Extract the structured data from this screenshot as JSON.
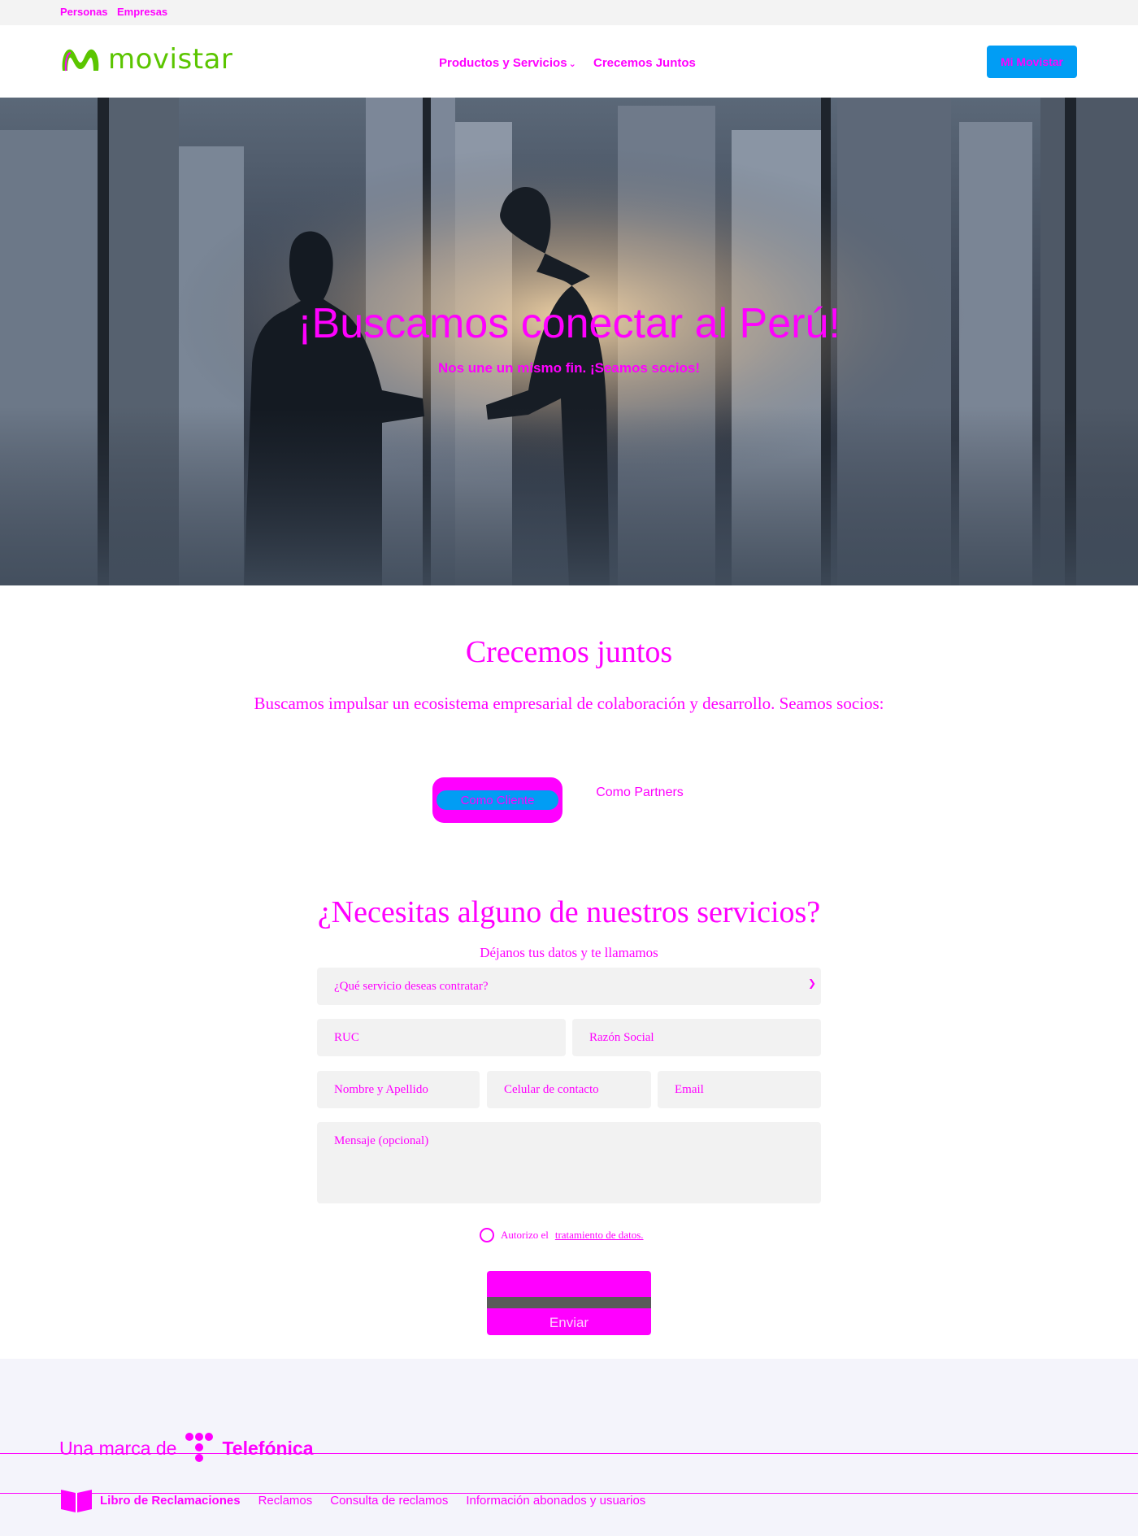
{
  "topbar": {
    "links": [
      "Personas",
      "Empresas"
    ]
  },
  "header": {
    "logo_text": "movistar",
    "nav": [
      {
        "label": "Productos y Servicios",
        "has_dropdown": true
      },
      {
        "label": "Crecemos Juntos",
        "has_dropdown": false
      }
    ],
    "cta_label": "Mi Movistar"
  },
  "hero": {
    "title": "¡Buscamos conectar al Perú!",
    "subtitle": "Nos une un mismo fin. ¡Seamos socios!"
  },
  "crecemos": {
    "title": "Crecemos juntos",
    "subtitle": "Buscamos impulsar un ecosistema empresarial de colaboración y desarrollo. Seamos socios:",
    "tabs": [
      {
        "label": "Como Cliente",
        "active": true
      },
      {
        "label": "Como Partners",
        "active": false
      }
    ]
  },
  "form": {
    "title": "¿Necesitas alguno de nuestros servicios?",
    "subtitle": "Déjanos tus datos y te llamamos",
    "service_select": "¿Qué servicio deseas contratar?",
    "ruc": "RUC",
    "razon_social": "Razón Social",
    "nombre": "Nombre y Apellido",
    "celular": "Celular de contacto",
    "email": "Email",
    "mensaje": "Mensaje (opcional)",
    "consent_prefix": "Autorizo el",
    "consent_link": "tratamiento de datos.",
    "submit": "Enviar"
  },
  "footer": {
    "brand_prefix": "Una marca de",
    "brand_name": "Telefónica",
    "links": [
      "Libro de Reclamaciones",
      "Reclamos",
      "Consulta de reclamos",
      "Información abonados y usuarios"
    ]
  },
  "colors": {
    "accent": "#ff00ff",
    "brand_blue": "#019df4",
    "brand_green": "#5bc500"
  },
  "icons": [
    "movistar-logo-icon",
    "chevron-down-icon",
    "telefonica-t-icon",
    "book-icon"
  ]
}
